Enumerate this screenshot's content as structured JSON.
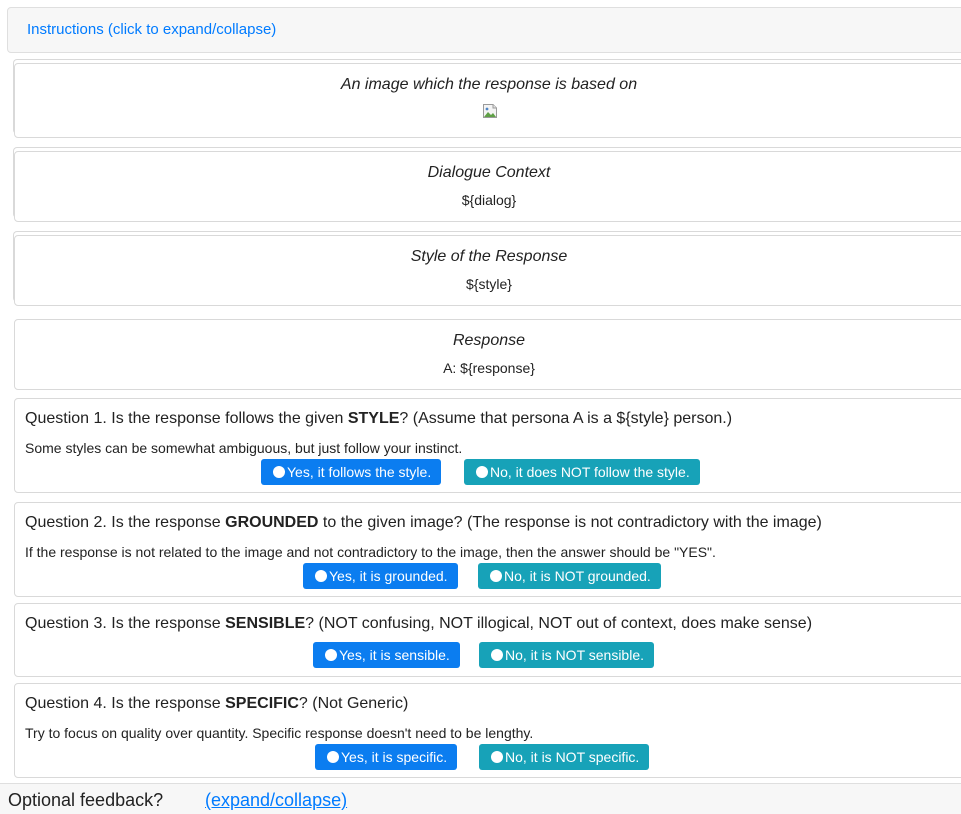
{
  "instructions": {
    "link_label": "Instructions (click to expand/collapse)"
  },
  "cards": {
    "image": {
      "title": "An image which the response is based on",
      "icon": "broken-image-icon"
    },
    "dialogue": {
      "title": "Dialogue Context",
      "value": "${dialog}"
    },
    "style": {
      "title": "Style of the Response",
      "value": "${style}"
    },
    "response": {
      "title": "Response",
      "value": "A: ${response}"
    }
  },
  "questions": [
    {
      "prefix": "Question 1. Is the response follows the given ",
      "keyword": "STYLE",
      "suffix": "? (Assume that persona A is a ${style} person.)",
      "hint": "Some styles can be somewhat ambiguous, but just follow your instinct.",
      "yes_label": "Yes, it follows the style.",
      "no_label": "No, it does NOT follow the style."
    },
    {
      "prefix": "Question 2. Is the response ",
      "keyword": "GROUNDED",
      "suffix": " to the given image? (The response is not contradictory with the image)",
      "hint": "If the response is not related to the image and not contradictory to the image, then the answer should be \"YES\".",
      "yes_label": "Yes, it is grounded.",
      "no_label": "No, it is NOT grounded."
    },
    {
      "prefix": "Question 3. Is the response ",
      "keyword": "SENSIBLE",
      "suffix": "? (NOT confusing, NOT illogical, NOT out of context, does make sense)",
      "hint": "",
      "yes_label": "Yes, it is sensible.",
      "no_label": "No, it is NOT sensible."
    },
    {
      "prefix": "Question 4. Is the response ",
      "keyword": "SPECIFIC",
      "suffix": "? (Not Generic)",
      "hint": "Try to focus on quality over quantity. Specific response doesn't need to be lengthy.",
      "yes_label": "Yes, it is specific.",
      "no_label": "No, it is NOT specific."
    }
  ],
  "feedback": {
    "label": "Optional feedback?",
    "link_label": "(expand/collapse)"
  },
  "colors": {
    "link": "#007bff",
    "yes_button": "#0b7df0",
    "no_button": "#17a2b8"
  }
}
